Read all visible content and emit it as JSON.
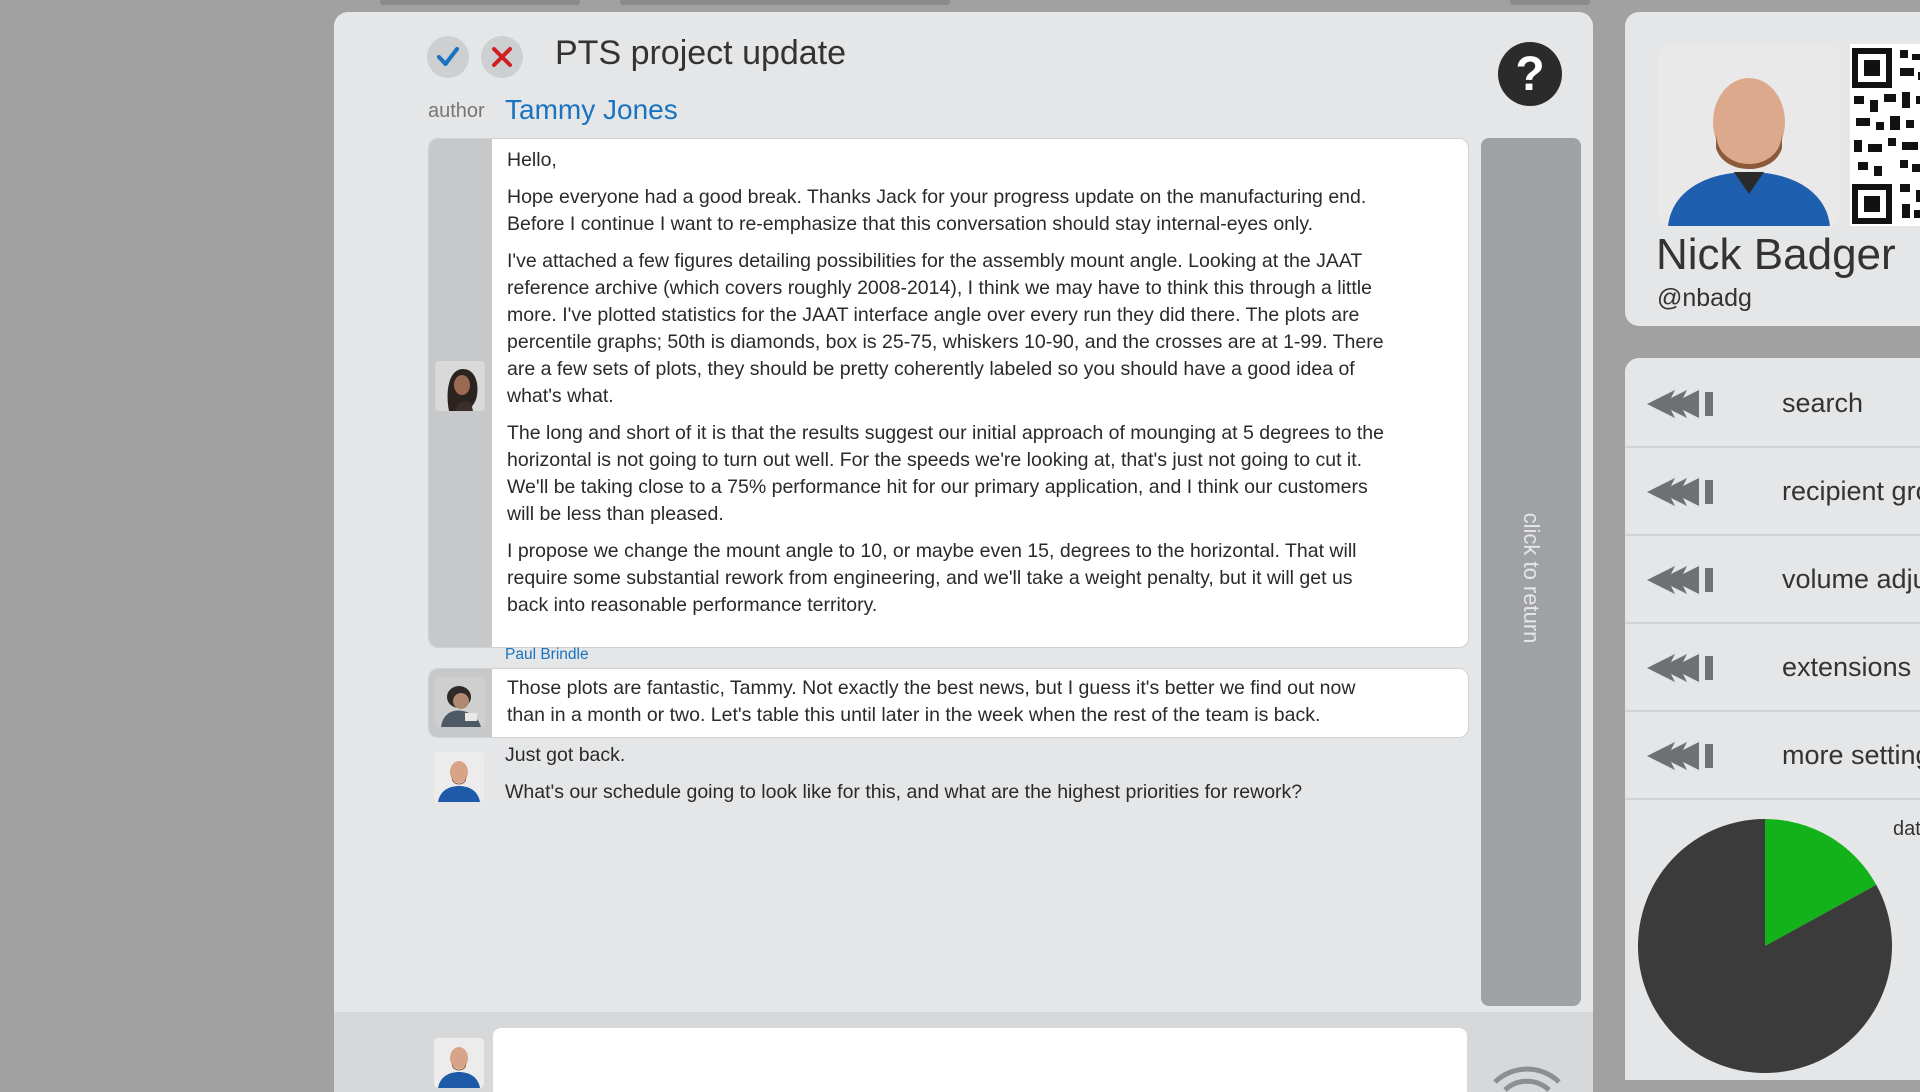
{
  "conversation": {
    "title": "PTS project update",
    "author_label": "author",
    "author_name": "Tammy Jones",
    "return_label": "click to return",
    "messages": [
      {
        "paragraphs": [
          "Hello,",
          "Hope everyone had a good break. Thanks Jack for your progress update on the manufacturing end. Before I continue I want to re-emphasize that this conversation should stay internal-eyes only.",
          "I've attached a few figures detailing possibilities for the assembly mount angle. Looking at the JAAT reference archive (which covers roughly 2008-2014), I think we may have to think this through a little more. I've plotted statistics for the JAAT interface angle over every run they did there. The plots are percentile graphs; 50th is diamonds, box is 25-75, whiskers 10-90, and the crosses are at 1-99. There are a few sets of plots, they should be pretty coherently labeled so you should have a good idea of what's what.",
          "The long and short of it is that the results suggest our initial approach of mounging at 5 degrees to the horizontal is not going to turn out well. For the speeds we're looking at, that's just not going to cut it. We'll be taking close to a 75% performance hit for our primary application, and I think our customers will be less than pleased.",
          "I propose we change the mount angle to 10, or maybe even 15, degrees to the horizontal. That will require some substantial rework from engineering, and we'll take a weight penalty, but it will get us back into reasonable performance territory."
        ]
      },
      {
        "sender": "Paul Brindle",
        "text": "Those plots are fantastic, Tammy. Not exactly the best news, but I guess it's better we find out now than in a month or two. Let's table this until later in the week when the rest of the team is back."
      },
      {
        "line1": "Just got back.",
        "line2": "What's our schedule going to look like for this, and what are the highest priorities for rework?"
      }
    ]
  },
  "profile": {
    "name": "Nick Badger",
    "handle": "@nbadg"
  },
  "menu": {
    "items": [
      {
        "label": "search"
      },
      {
        "label": "recipient gro"
      },
      {
        "label": "volume adju"
      },
      {
        "label": "extensions"
      },
      {
        "label": "more setting"
      }
    ],
    "pie_label": "dat"
  },
  "pie_data": {
    "type": "pie",
    "values": [
      0.17,
      0.83
    ],
    "colors": [
      "#13b21a",
      "#3b3b3b"
    ]
  },
  "colors": {
    "accent": "#1a73c0",
    "panel": "#e5e6e7",
    "background": "#a1a1a1",
    "check": "#1a73c0",
    "cross": "#d02020"
  },
  "icons": {
    "accept": "check-icon",
    "reject": "close-icon",
    "help": "question-icon",
    "menu": "rewind-icon",
    "signal": "wifi-icon"
  }
}
